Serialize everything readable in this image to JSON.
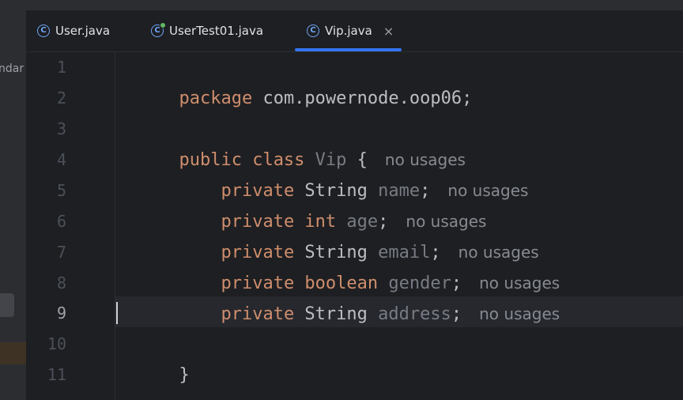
{
  "left_panel": {
    "truncated_text": "ndar"
  },
  "tabs": [
    {
      "label": "User.java",
      "active": false,
      "running": false
    },
    {
      "label": "UserTest01.java",
      "active": false,
      "running": true
    },
    {
      "label": "Vip.java",
      "active": true,
      "running": false
    }
  ],
  "tab_icon_letter": "C",
  "close_glyph": "×",
  "line_numbers": [
    "1",
    "2",
    "3",
    "4",
    "5",
    "6",
    "7",
    "8",
    "9",
    "10",
    "11"
  ],
  "current_line": 9,
  "code": {
    "line1": {
      "kw": "package",
      "rest": " com.powernode.oop06;"
    },
    "line3": {
      "kw": "public class",
      "name": " Vip",
      "brace": " {",
      "hint": "no usages"
    },
    "line4": {
      "kw": "private",
      "type": " String",
      "field": " name",
      "semi": ";",
      "hint": "no usages"
    },
    "line5": {
      "kw": "private",
      "type": " int",
      "field": " age",
      "semi": ";",
      "hint": "no usages"
    },
    "line6": {
      "kw": "private",
      "type": " String",
      "field": " email",
      "semi": ";",
      "hint": "no usages"
    },
    "line7": {
      "kw": "private",
      "type": " boolean",
      "field": " gender",
      "semi": ";",
      "hint": "no usages"
    },
    "line8": {
      "kw": "private",
      "type": " String",
      "field": " address",
      "semi": ";",
      "hint": "no usages"
    },
    "line10": {
      "brace": "}"
    }
  },
  "colors": {
    "keyword": "#cf8e6d",
    "field": "#777b83",
    "text": "#bcbec4",
    "accent": "#3574f0",
    "icon": "#6ea5f5"
  }
}
